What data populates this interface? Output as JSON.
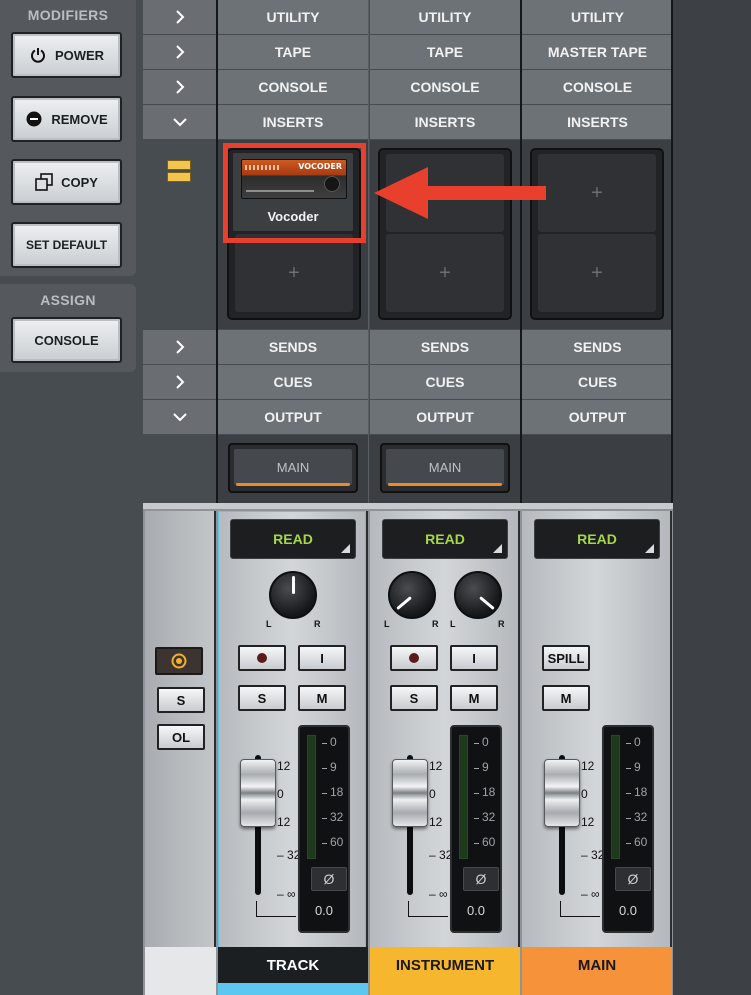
{
  "modifiers": {
    "title": "MODIFIERS",
    "buttons": [
      {
        "label": "POWER",
        "icon": "power-icon"
      },
      {
        "label": "REMOVE",
        "icon": "remove-icon"
      },
      {
        "label": "COPY",
        "icon": "copy-icon"
      },
      {
        "label": "SET DEFAULT",
        "icon": ""
      }
    ]
  },
  "assign": {
    "title": "ASSIGN",
    "button": "CONSOLE"
  },
  "sections": {
    "utility": [
      "UTILITY",
      "UTILITY",
      "UTILITY"
    ],
    "tape": [
      "TAPE",
      "TAPE",
      "MASTER TAPE"
    ],
    "console": [
      "CONSOLE",
      "CONSOLE",
      "CONSOLE"
    ],
    "inserts": [
      "INSERTS",
      "INSERTS",
      "INSERTS"
    ],
    "sends": [
      "SENDS",
      "SENDS",
      "SENDS"
    ],
    "cues": [
      "CUES",
      "CUES",
      "CUES"
    ],
    "output": [
      "OUTPUT",
      "OUTPUT",
      "OUTPUT"
    ]
  },
  "inserts": {
    "plugin_name": "Vocoder",
    "plugin_brand": "VOCODER",
    "empty_slot": "+"
  },
  "outputs": [
    "MAIN",
    "MAIN"
  ],
  "left_strip": {
    "solo": "S",
    "ol": "OL"
  },
  "strips": [
    {
      "name": "TRACK",
      "automation": "READ",
      "pan_left": "L",
      "pan_right": "R",
      "buttons": [
        "I",
        "S",
        "M"
      ],
      "fader_scale": [
        "12",
        "0",
        "12",
        "32",
        "∞"
      ],
      "meter_scale": [
        "0",
        "9",
        "18",
        "32",
        "60"
      ],
      "phase": "Ø",
      "level": "0.0",
      "color": "#5cc8ef",
      "name_bg": "#1b1f22",
      "name_color": "#ffffff"
    },
    {
      "name": "INSTRUMENT",
      "automation": "READ",
      "pan_left": "L",
      "pan_right": "R",
      "buttons": [
        "I",
        "S",
        "M"
      ],
      "fader_scale": [
        "12",
        "0",
        "12",
        "32",
        "∞"
      ],
      "meter_scale": [
        "0",
        "9",
        "18",
        "32",
        "60"
      ],
      "phase": "Ø",
      "level": "0.0",
      "color": "#f6b72e",
      "name_bg": "#f6b72e",
      "name_color": "#1a1a1a"
    },
    {
      "name": "MAIN",
      "automation": "READ",
      "buttons": [
        "SPILL",
        "M"
      ],
      "fader_scale": [
        "12",
        "0",
        "12",
        "32",
        "∞"
      ],
      "meter_scale": [
        "0",
        "9",
        "18",
        "32",
        "60"
      ],
      "phase": "Ø",
      "level": "0.0",
      "color": "#f5923a",
      "name_bg": "#f5923a",
      "name_color": "#1a1a1a"
    }
  ],
  "colors": {
    "accent_annotation": "#e8402c",
    "automation_text": "#a6d64a",
    "output_bar": "#ef8a2a"
  }
}
